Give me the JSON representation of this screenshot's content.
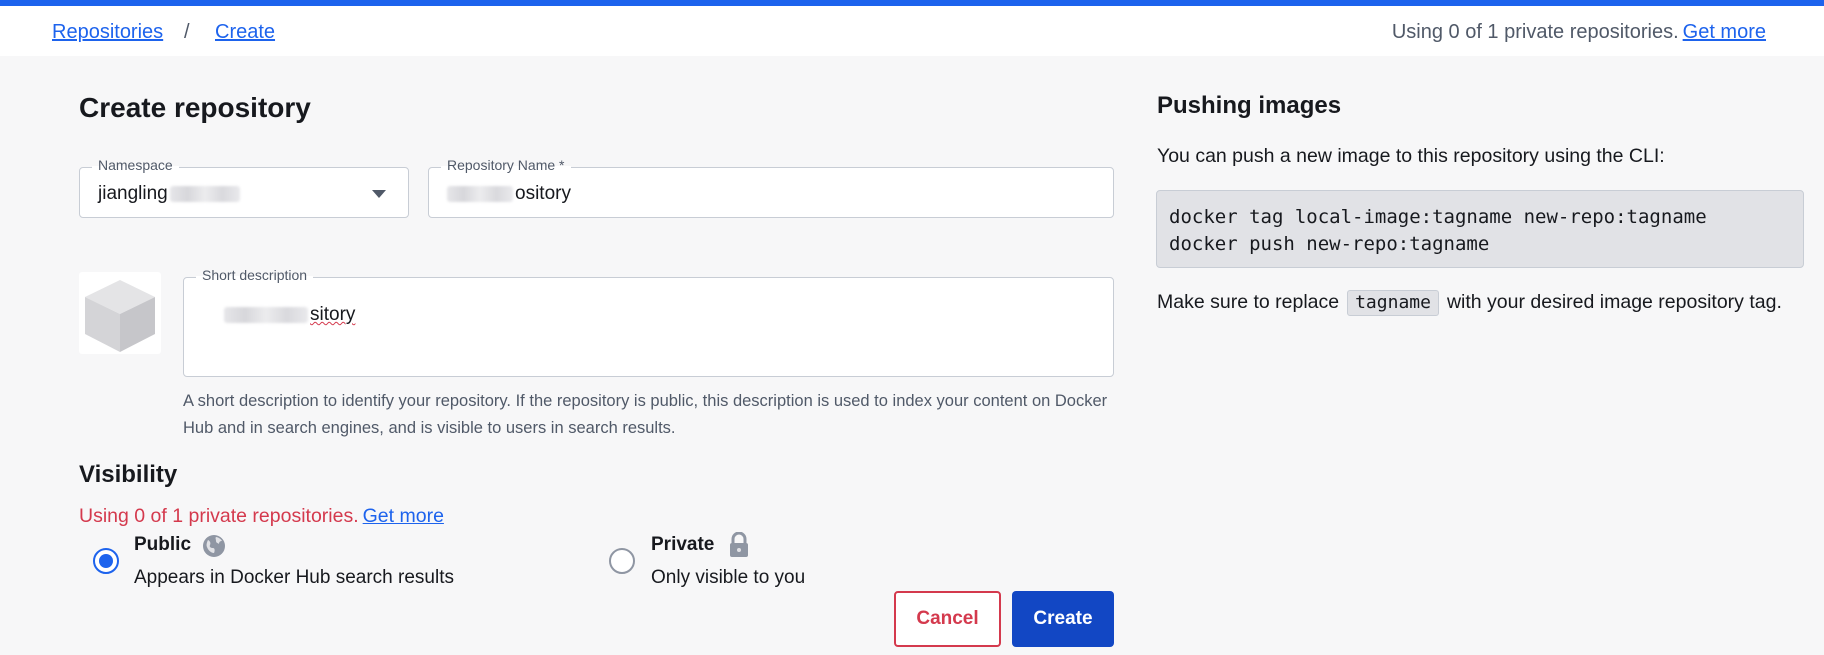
{
  "breadcrumb": {
    "items": [
      "Repositories",
      "Create"
    ],
    "separator": "/"
  },
  "quota_top": {
    "text": "Using 0 of 1 private repositories.",
    "link": "Get more"
  },
  "page_title": "Create repository",
  "namespace": {
    "label": "Namespace",
    "value_visible": "jiangling"
  },
  "repo_name": {
    "label": "Repository Name *",
    "value_visible": "ository"
  },
  "short_description": {
    "label": "Short description",
    "value_visible": "sitory",
    "helper": "A short description to identify your repository. If the repository is public, this description is used to index your content on Docker Hub and in search engines, and is visible to users in search results."
  },
  "visibility": {
    "title": "Visibility",
    "quota_text": "Using 0 of 1 private repositories.",
    "quota_link": "Get more",
    "options": [
      {
        "title": "Public",
        "desc": "Appears in Docker Hub search results",
        "icon": "globe-icon",
        "selected": true
      },
      {
        "title": "Private",
        "desc": "Only visible to you",
        "icon": "lock-icon",
        "selected": false
      }
    ]
  },
  "actions": {
    "cancel": "Cancel",
    "create": "Create"
  },
  "pushing": {
    "title": "Pushing images",
    "subtitle": "You can push a new image to this repository using the CLI:",
    "code_lines": [
      "docker tag local-image:tagname new-repo:tagname",
      "docker push new-repo:tagname"
    ],
    "note_before": "Make sure to replace",
    "note_code": "tagname",
    "note_after": "with your desired image repository tag."
  },
  "colors": {
    "accent": "#1d63ed",
    "danger": "#d4394d",
    "create_button": "#1247c4"
  }
}
